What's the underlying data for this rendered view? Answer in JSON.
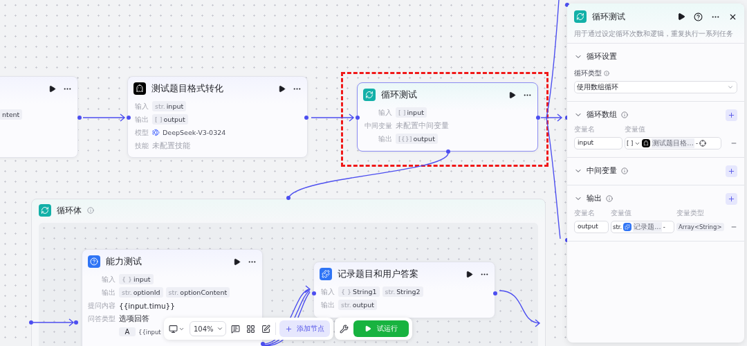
{
  "nodes": [
    {
      "kind": "unknown",
      "selected": false,
      "rows": [
        {
          "kind": "chips",
          "chips": [
            {
              "value": "ntent"
            }
          ]
        }
      ]
    },
    {
      "kind": "llm",
      "selected": false,
      "title": "测试题目格式转化",
      "rows": [
        {
          "kind": "chips",
          "label": "输入",
          "chips": [
            {
              "type": "str.",
              "value": "input"
            }
          ]
        },
        {
          "kind": "chips",
          "label": "输出",
          "chips": [
            {
              "type": "[ ]",
              "value": "output"
            }
          ]
        },
        {
          "kind": "model",
          "label": "模型",
          "value": "DeepSeek-V3-0324"
        },
        {
          "kind": "muted",
          "label": "技能",
          "value": "未配置技能"
        }
      ]
    },
    {
      "kind": "loop",
      "selected": true,
      "title": "循环测试",
      "rows": [
        {
          "kind": "chips",
          "label": "输入",
          "chips": [
            {
              "type": "[ ]",
              "value": "input"
            }
          ]
        },
        {
          "kind": "muted",
          "label": "中间变量",
          "value": "未配置中间变量"
        },
        {
          "kind": "chips",
          "label": "输出",
          "chips": [
            {
              "type": "[{}]",
              "value": "output"
            }
          ]
        }
      ]
    }
  ],
  "loop_body": {
    "title": "循环体",
    "nodes": [
      {
        "kind": "question",
        "selected": false,
        "title": "能力测试",
        "rows": [
          {
            "kind": "chips",
            "label": "输入",
            "chips": [
              {
                "type": "{ }",
                "value": "input"
              }
            ]
          },
          {
            "kind": "chips",
            "label": "输出",
            "chips": [
              {
                "type": "str.",
                "value": "optionId"
              },
              {
                "type": "str.",
                "value": "optionContent"
              }
            ]
          },
          {
            "kind": "text",
            "label": "提问内容",
            "value": "{{input.timu}}"
          },
          {
            "kind": "text",
            "label": "问答类型",
            "value": "选项回答"
          },
          {
            "kind": "option",
            "key": "A",
            "value": "{{input"
          }
        ]
      },
      {
        "kind": "code",
        "selected": false,
        "title": "记录题目和用户答案",
        "rows": [
          {
            "kind": "chips",
            "label": "输入",
            "chips": [
              {
                "type": "{ }",
                "value": "String1"
              },
              {
                "type": "str.",
                "value": "String2"
              }
            ]
          },
          {
            "kind": "chips",
            "label": "输出",
            "chips": [
              {
                "type": "str.",
                "value": "output"
              }
            ]
          }
        ]
      }
    ]
  },
  "toolbar": {
    "zoom": "104%",
    "add_node": "添加节点",
    "run": "试运行"
  },
  "panel": {
    "title": "循环测试",
    "description": "用于通过设定循环次数和逻辑，重复执行一系列任务",
    "sections": [
      {
        "kind": "setting",
        "title": "循环设置",
        "expanded": true,
        "info": false,
        "field_label": "循环类型",
        "select": "使用数组循环"
      },
      {
        "kind": "variables",
        "title": "循环数组",
        "expanded": true,
        "info": true,
        "columns": [
          "变量名",
          "变量值"
        ],
        "rows": [
          {
            "name": "input",
            "type": "[ ]",
            "kind": "llm",
            "ref": "测试题目格...",
            "clear": "-"
          }
        ]
      },
      {
        "kind": "variables",
        "title": "中间变量",
        "expanded": true,
        "info": true
      },
      {
        "kind": "variables",
        "title": "输出",
        "expanded": true,
        "info": true,
        "columns": [
          "变量名",
          "变量值",
          "变量类型"
        ],
        "rows": [
          {
            "name": "output",
            "type": "str.",
            "kind": "code",
            "ref": "记录题...",
            "clear": "-",
            "value_type": "Array<String>"
          }
        ]
      }
    ]
  }
}
